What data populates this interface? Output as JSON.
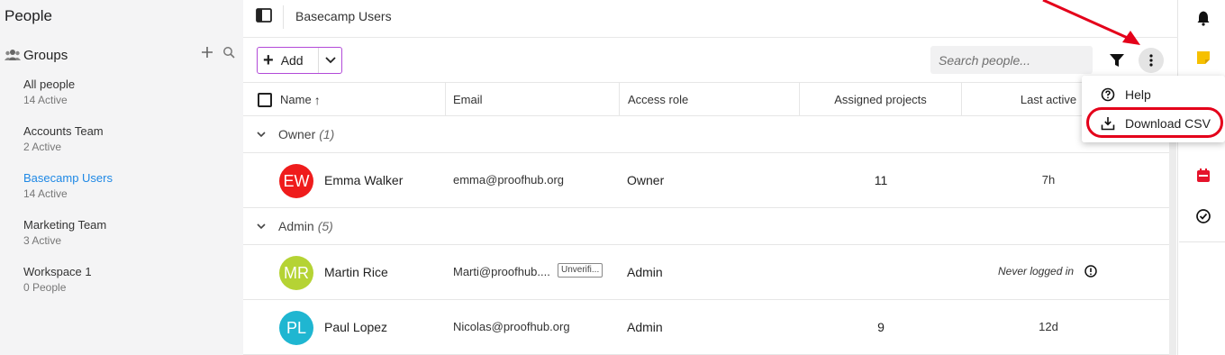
{
  "sidebar": {
    "title": "People",
    "groups_label": "Groups",
    "groups": [
      {
        "name": "All people",
        "count": "14 Active"
      },
      {
        "name": "Accounts Team",
        "count": "2 Active"
      },
      {
        "name": "Basecamp Users",
        "count": "14 Active"
      },
      {
        "name": "Marketing Team",
        "count": "3 Active"
      },
      {
        "name": "Workspace 1",
        "count": "0 People"
      }
    ],
    "active_group": "Basecamp Users"
  },
  "header": {
    "breadcrumb": "Basecamp Users"
  },
  "toolbar": {
    "add_label": "Add",
    "search_placeholder": "Search people..."
  },
  "table": {
    "columns": {
      "name": "Name",
      "email": "Email",
      "role": "Access role",
      "projects": "Assigned projects",
      "last_active": "Last active"
    },
    "groups": [
      {
        "label": "Owner",
        "count": "(1)",
        "rows": [
          {
            "initials": "EW",
            "name": "Emma Walker",
            "email": "emma@proofhub.org",
            "role": "Owner",
            "projects": "11",
            "last_active": "7h",
            "avatar_color": "#ef1c1c"
          }
        ]
      },
      {
        "label": "Admin",
        "count": "(5)",
        "rows": [
          {
            "initials": "MR",
            "name": "Martin Rice",
            "email": "Marti@proofhub....",
            "badge": "Unverifi...",
            "role": "Admin",
            "projects": "",
            "last_active": "Never logged in",
            "avatar_color": "#b5d334"
          },
          {
            "initials": "PL",
            "name": "Paul Lopez",
            "email": "Nicolas@proofhub.org",
            "role": "Admin",
            "projects": "9",
            "last_active": "12d",
            "avatar_color": "#1fb6d1"
          }
        ]
      }
    ]
  },
  "menu": {
    "items": [
      {
        "label": "Help",
        "icon": "help-circle-icon"
      },
      {
        "label": "Download CSV",
        "icon": "download-icon"
      }
    ]
  },
  "rail": {
    "icons": [
      "bell-icon",
      "sticky-note-icon",
      "calendar-icon",
      "timer-icon"
    ]
  },
  "colors": {
    "accent_link": "#1e88e5",
    "add_border": "#b24ad8",
    "annotation_red": "#e4001a",
    "sticky_yellow": "#f6c000",
    "calendar_red": "#e5132b"
  }
}
